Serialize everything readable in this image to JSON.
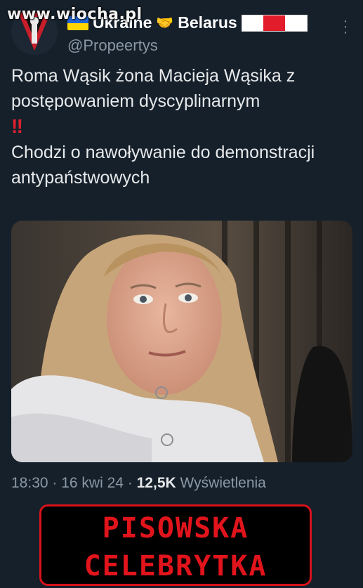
{
  "watermark": "www.wiocha.pl",
  "profile": {
    "display_name_1": "Ukraine",
    "display_name_2": "Belarus",
    "handle": "@Propeertys",
    "handshake_icon": "🤝"
  },
  "tweet": {
    "line1": "Roma Wąsik żona Macieja Wąsika z postępowaniem dyscyplinarnym",
    "bangs": "‼",
    "line2": "Chodzi o nawoływanie do demonstracji antypaństwowych"
  },
  "meta": {
    "time": "18:30",
    "date": "16 kwi 24",
    "views_count": "12,5K",
    "views_label": "Wyświetlenia"
  },
  "banner": {
    "line1": "PISOWSKA",
    "line2": "CELEBRYTKA"
  },
  "colors": {
    "background": "#15202b",
    "banner_red": "#e1141c"
  }
}
